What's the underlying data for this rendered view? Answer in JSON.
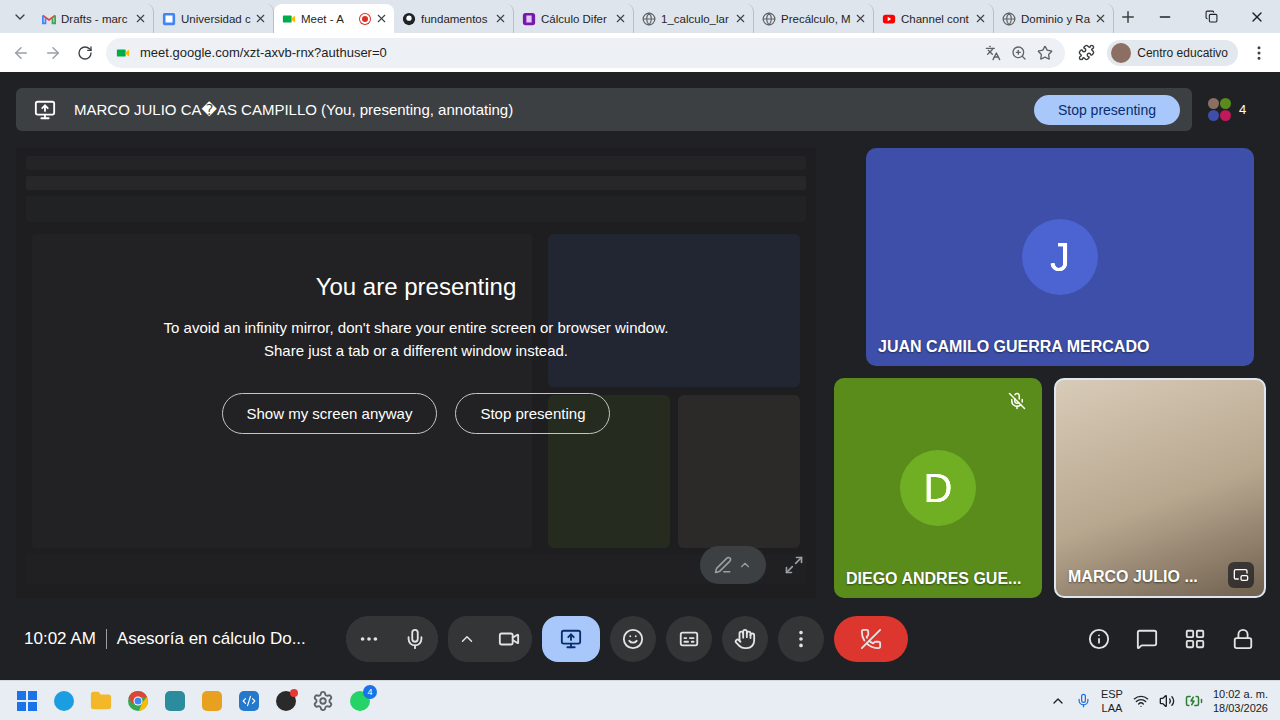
{
  "browser": {
    "tabs": [
      {
        "label": "Drafts - marc",
        "kind": "gmail",
        "selected": false,
        "recording": false
      },
      {
        "label": "Universidad c",
        "kind": "calendar",
        "selected": false,
        "recording": false
      },
      {
        "label": "Meet - A",
        "kind": "meet",
        "selected": true,
        "recording": true
      },
      {
        "label": "fundamentos",
        "kind": "github",
        "selected": false,
        "recording": false
      },
      {
        "label": "Cálculo Difer",
        "kind": "onenote",
        "selected": false,
        "recording": false
      },
      {
        "label": "1_calculo_lar",
        "kind": "web",
        "selected": false,
        "recording": false
      },
      {
        "label": "Precálculo, M",
        "kind": "web",
        "selected": false,
        "recording": false
      },
      {
        "label": "Channel cont",
        "kind": "youtube",
        "selected": false,
        "recording": false
      },
      {
        "label": "Dominio y Ra",
        "kind": "web",
        "selected": false,
        "recording": false
      }
    ],
    "url": "meet.google.com/xzt-axvb-rnx?authuser=0",
    "profile": "Centro educativo"
  },
  "meet": {
    "banner": {
      "title": "MARCO JULIO CA�AS CAMPILLO (You, presenting, annotating)",
      "button": "Stop presenting"
    },
    "participants_count": "4",
    "presenting_notice": {
      "title": "You are presenting",
      "lines": [
        "To avoid an infinity mirror, don't share your entire screen or browser window.",
        "Share just a tab or a different window instead."
      ],
      "buttons": [
        "Show my screen anyway",
        "Stop presenting"
      ]
    },
    "tiles": [
      {
        "name": "JUAN CAMILO GUERRA MERCADO",
        "initial": "J",
        "kind": "avatar",
        "color": "#3d4fa8",
        "muted": false
      },
      {
        "name": "DIEGO ANDRES GUE...",
        "initial": "D",
        "kind": "avatar",
        "color": "#5a8c1c",
        "muted": true
      },
      {
        "name": "MARCO JULIO ...",
        "initial": "",
        "kind": "video",
        "color": "#b8a78f",
        "muted": false
      }
    ],
    "time": "10:02 AM",
    "meeting_title": "Asesoría en cálculo Do...",
    "control_groups": [
      [
        {
          "kind": "more",
          "active": false
        },
        {
          "kind": "mic",
          "active": false
        }
      ],
      [
        {
          "kind": "options",
          "active": false
        },
        {
          "kind": "camera",
          "active": false
        }
      ],
      [
        {
          "kind": "present",
          "active": true
        }
      ],
      [
        {
          "kind": "emoji",
          "active": false
        }
      ],
      [
        {
          "kind": "captions",
          "active": false
        }
      ],
      [
        {
          "kind": "hand",
          "active": false
        }
      ],
      [
        {
          "kind": "overflow",
          "active": false
        }
      ],
      [
        {
          "kind": "end",
          "active": false
        }
      ]
    ],
    "side_controls": [
      {
        "kind": "info"
      },
      {
        "kind": "chat"
      },
      {
        "kind": "activities"
      },
      {
        "kind": "host"
      }
    ]
  },
  "taskbar": {
    "apps": [
      {
        "kind": "start",
        "color": "#1a73e8",
        "badge": ""
      },
      {
        "kind": "edge",
        "color": "#1b9de2",
        "badge": ""
      },
      {
        "kind": "folder",
        "color": "#f3b72a",
        "badge": ""
      },
      {
        "kind": "chrome",
        "color": "#db4437",
        "badge": ""
      },
      {
        "kind": "app",
        "color": "#2b8c9e",
        "badge": ""
      },
      {
        "kind": "app",
        "color": "#e8a020",
        "badge": ""
      },
      {
        "kind": "vscode",
        "color": "#2479cc",
        "badge": ""
      },
      {
        "kind": "record",
        "color": "#2a2a2a",
        "badge": ""
      },
      {
        "kind": "settings",
        "color": "#5f6368",
        "badge": ""
      },
      {
        "kind": "whatsapp",
        "color": "#25d366",
        "badge": "4"
      }
    ],
    "tray": {
      "lang": "ESP",
      "layout": "LAA",
      "time": "10:02 a. m.",
      "date": "18/03/2026"
    }
  }
}
